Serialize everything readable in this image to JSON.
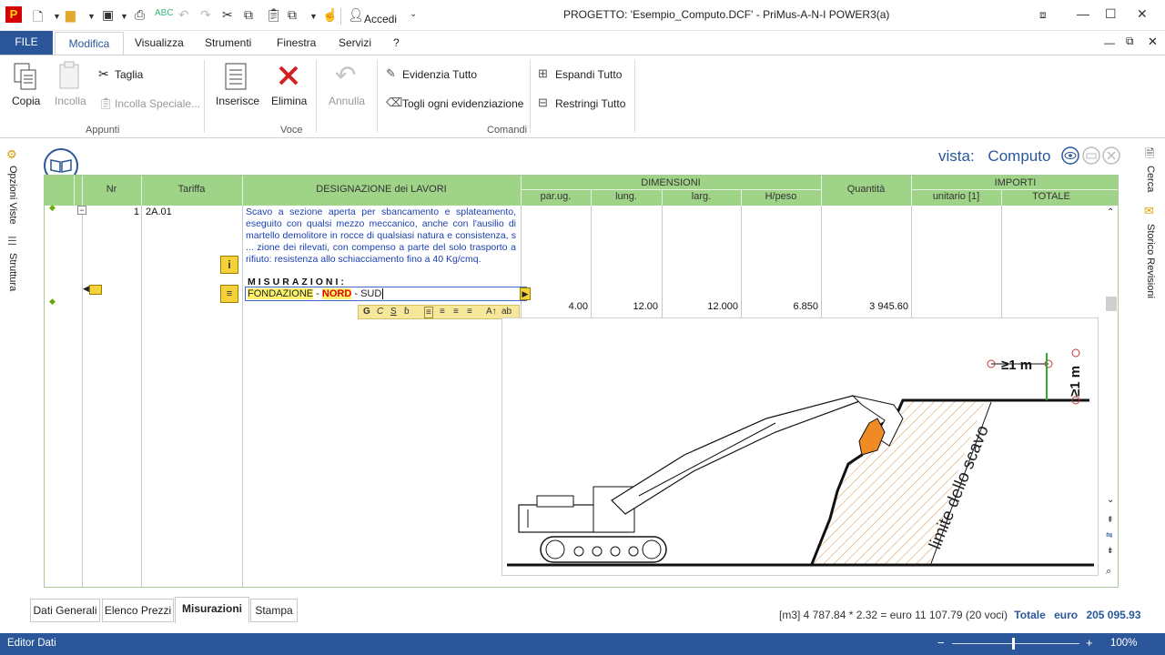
{
  "titlebar": {
    "title": "PROGETTO: 'Esempio_Computo.DCF' - PriMus-A-N-I   POWER3(a)",
    "accedi": "Accedi"
  },
  "menu": {
    "file": "FILE",
    "items": [
      "Modifica",
      "Visualizza",
      "Strumenti",
      "Finestra",
      "Servizi",
      "?"
    ]
  },
  "ribbon": {
    "copia": "Copia",
    "incolla": "Incolla",
    "taglia": "Taglia",
    "incolla_speciale": "Incolla Speciale...",
    "inserisce": "Inserisce",
    "elimina": "Elimina",
    "annulla": "Annulla",
    "evidenzia_tutto": "Evidenzia Tutto",
    "togli_evidenziazione": "Togli ogni evidenziazione",
    "espandi_tutto": "Espandi Tutto",
    "restringi_tutto": "Restringi Tutto",
    "groups": [
      "Appunti",
      "Voce",
      "Comandi"
    ]
  },
  "sidebar_left": [
    "Opzioni Viste",
    "Struttura"
  ],
  "sidebar_right": [
    "Cerca",
    "Storico Revisioni"
  ],
  "vista": {
    "label": "vista:",
    "value": "Computo"
  },
  "grid": {
    "headers": {
      "nr": "Nr",
      "tariffa": "Tariffa",
      "designazione": "DESIGNAZIONE dei LAVORI",
      "dimensioni": "DIMENSIONI",
      "par_ug": "par.ug.",
      "lung": "lung.",
      "larg": "larg.",
      "hpeso": "H/peso",
      "quantita": "Quantità",
      "importi": "IMPORTI",
      "unitario": "unitario [1]",
      "totale": "TOTALE"
    },
    "row": {
      "nr": "1",
      "tariffa": "2A.01",
      "description": "Scavo a sezione aperta per sbancamento e splateamento, eseguito con qualsi mezzo meccanico, anche con l'ausilio di martello demolitore in rocce di qualsiasi natura e consistenza, s ... zione dei rilevati, con compenso a parte del solo trasporto a rifiuto: resistenza allo schiacciamento fino a 40 Kg/cmq.",
      "misurazioni": "MISURAZIONI:",
      "meas_part1": "FONDAZIONE",
      "meas_sep1": " - ",
      "meas_part2": "NORD",
      "meas_sep2": " - ",
      "meas_part3": "SUD",
      "lung": "4.00",
      "larg": "12.00",
      "larg2": "12.000",
      "hpeso": "6.850",
      "quantita": "3 945.60"
    },
    "format_bar": [
      "G",
      "C",
      "S",
      "ab"
    ],
    "drawing": {
      "label_1": "≥1 m",
      "label_2": "≥1 m",
      "label_3": "limite dello scavo"
    }
  },
  "bottom_tabs": [
    "Dati Generali",
    "Elenco Prezzi",
    "Misurazioni",
    "Stampa"
  ],
  "summary": {
    "text": "[m3] 4 787.84 * 2.32 = euro 11 107.79  (20 voci)",
    "totale_label": "Totale",
    "euro_label": "euro",
    "totale_value": "205 095.93"
  },
  "statusbar": {
    "left": "Editor Dati",
    "zoom": "100%"
  },
  "colors": {
    "accent": "#2b579a",
    "grid_header": "#9fd388",
    "highlight_yellow": "#fff36b",
    "red_keyword": "#e00000"
  }
}
